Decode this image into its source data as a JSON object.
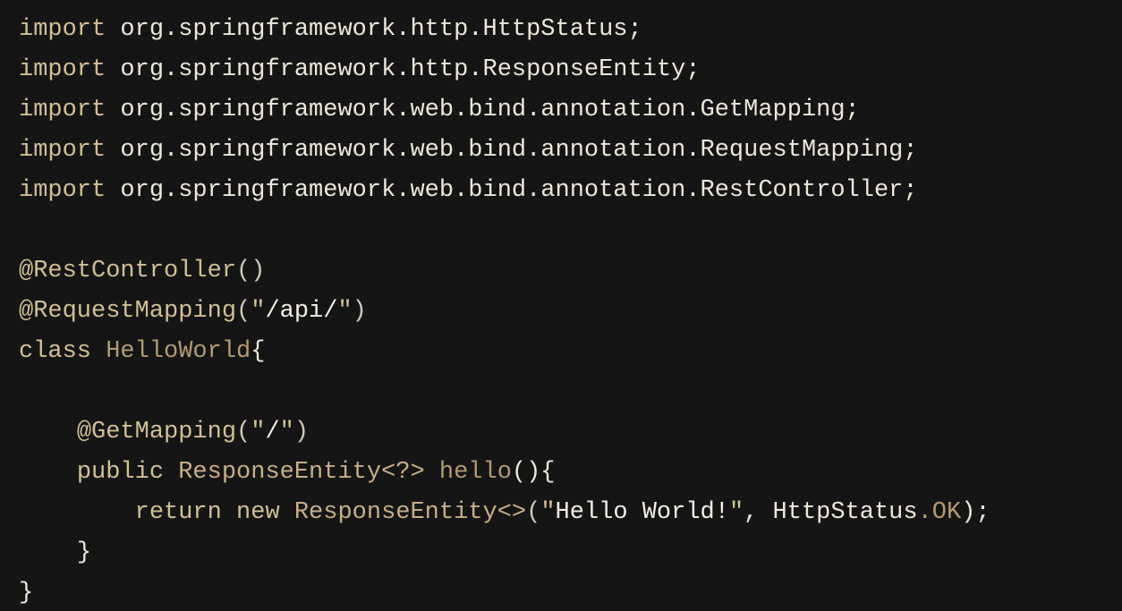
{
  "editor": {
    "language": "java",
    "colors": {
      "background": "#151515",
      "keyword": "#d2bf93",
      "plain": "#ede7da",
      "string": "#f4efe6",
      "type": "#c7ae85",
      "identifier": "#b29a72"
    },
    "lines": [
      {
        "tokens": [
          {
            "t": "import",
            "k": "keyword"
          },
          {
            "t": " org.springframework.http.HttpStatus;",
            "k": "plain"
          }
        ]
      },
      {
        "tokens": [
          {
            "t": "import",
            "k": "keyword"
          },
          {
            "t": " org.springframework.http.ResponseEntity;",
            "k": "plain"
          }
        ]
      },
      {
        "tokens": [
          {
            "t": "import",
            "k": "keyword"
          },
          {
            "t": " org.springframework.web.bind.annotation.GetMapping;",
            "k": "plain"
          }
        ]
      },
      {
        "tokens": [
          {
            "t": "import",
            "k": "keyword"
          },
          {
            "t": " org.springframework.web.bind.annotation.RequestMapping;",
            "k": "plain"
          }
        ]
      },
      {
        "tokens": [
          {
            "t": "import",
            "k": "keyword"
          },
          {
            "t": " org.springframework.web.bind.annotation.RestController;",
            "k": "plain"
          }
        ]
      },
      {
        "tokens": []
      },
      {
        "tokens": [
          {
            "t": "@RestController",
            "k": "annot"
          },
          {
            "t": "()",
            "k": "paren"
          }
        ]
      },
      {
        "tokens": [
          {
            "t": "@RequestMapping",
            "k": "annot"
          },
          {
            "t": "(",
            "k": "paren"
          },
          {
            "t": "\"",
            "k": "quote"
          },
          {
            "t": "/api/",
            "k": "string"
          },
          {
            "t": "\"",
            "k": "quote"
          },
          {
            "t": ")",
            "k": "paren"
          }
        ]
      },
      {
        "tokens": [
          {
            "t": "class",
            "k": "keyword"
          },
          {
            "t": " ",
            "k": "plain"
          },
          {
            "t": "HelloWorld",
            "k": "classname"
          },
          {
            "t": "{",
            "k": "punct"
          }
        ]
      },
      {
        "tokens": []
      },
      {
        "tokens": [
          {
            "t": "    ",
            "k": "plain"
          },
          {
            "t": "@GetMapping",
            "k": "annot"
          },
          {
            "t": "(",
            "k": "paren"
          },
          {
            "t": "\"",
            "k": "quote"
          },
          {
            "t": "/",
            "k": "string"
          },
          {
            "t": "\"",
            "k": "quote"
          },
          {
            "t": ")",
            "k": "paren"
          }
        ]
      },
      {
        "tokens": [
          {
            "t": "    ",
            "k": "plain"
          },
          {
            "t": "public",
            "k": "keyword"
          },
          {
            "t": " ",
            "k": "plain"
          },
          {
            "t": "ResponseEntity",
            "k": "type"
          },
          {
            "t": "<?>",
            "k": "generic"
          },
          {
            "t": " ",
            "k": "plain"
          },
          {
            "t": "hello",
            "k": "method"
          },
          {
            "t": "(){",
            "k": "punct"
          }
        ]
      },
      {
        "tokens": [
          {
            "t": "        ",
            "k": "plain"
          },
          {
            "t": "return",
            "k": "keyword"
          },
          {
            "t": " ",
            "k": "plain"
          },
          {
            "t": "new",
            "k": "keyword"
          },
          {
            "t": " ",
            "k": "plain"
          },
          {
            "t": "ResponseEntity",
            "k": "type"
          },
          {
            "t": "<>",
            "k": "generic"
          },
          {
            "t": "(",
            "k": "paren"
          },
          {
            "t": "\"",
            "k": "quote"
          },
          {
            "t": "Hello World!",
            "k": "string"
          },
          {
            "t": "\"",
            "k": "quote"
          },
          {
            "t": ", HttpStatus",
            "k": "plain"
          },
          {
            "t": ".OK",
            "k": "const"
          },
          {
            "t": ");",
            "k": "punct"
          }
        ]
      },
      {
        "tokens": [
          {
            "t": "    ",
            "k": "plain"
          },
          {
            "t": "}",
            "k": "punct"
          }
        ]
      },
      {
        "tokens": [
          {
            "t": "}",
            "k": "punct"
          }
        ]
      }
    ]
  }
}
